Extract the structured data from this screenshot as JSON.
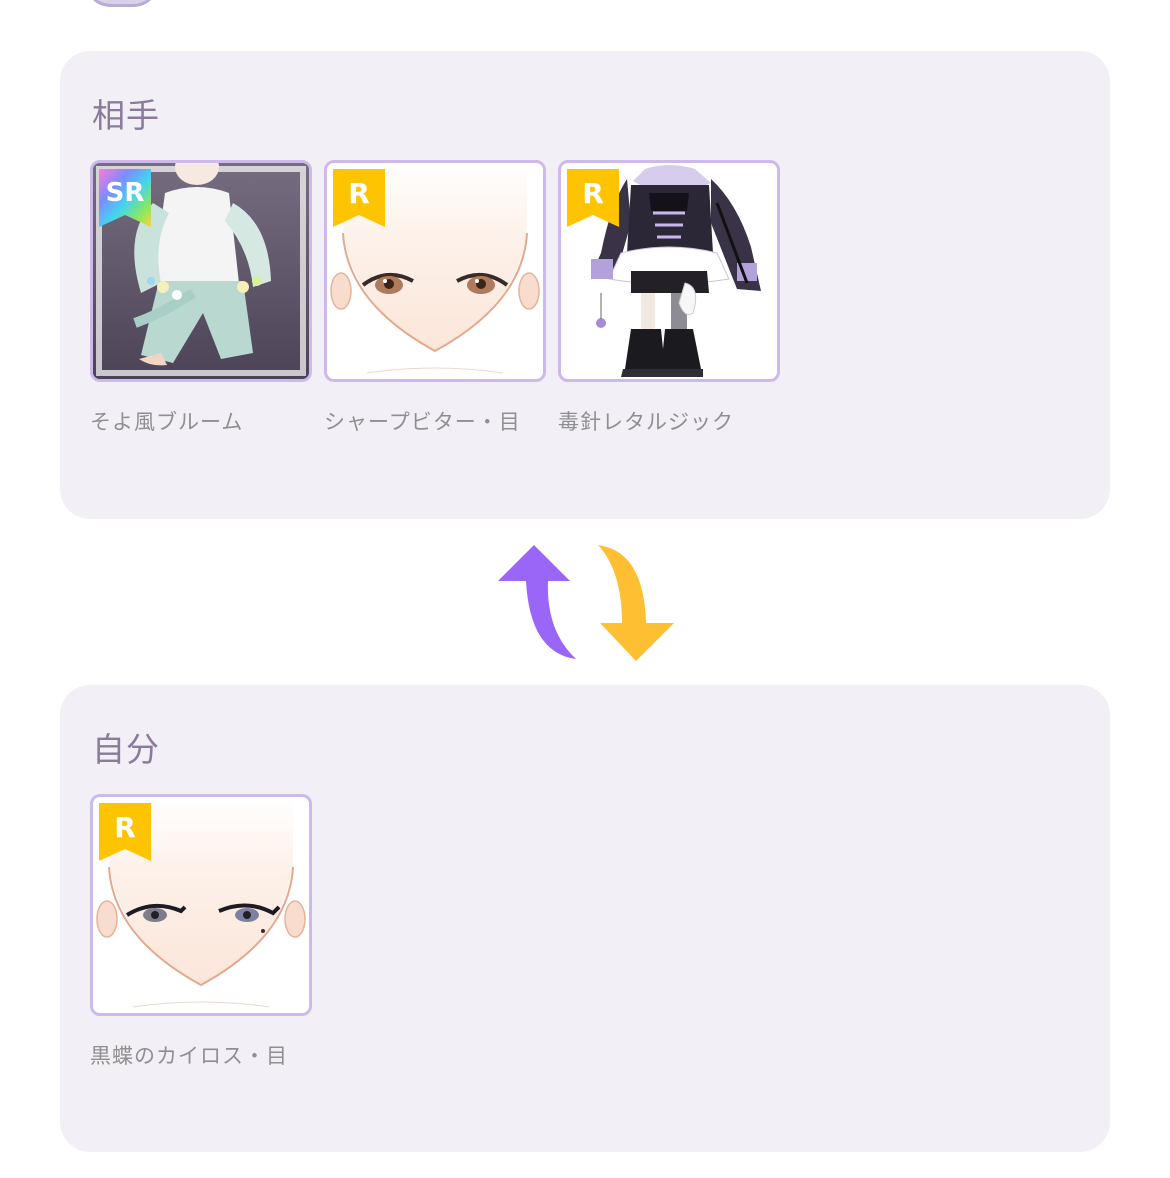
{
  "partner": {
    "title": "相手",
    "items": [
      {
        "name": "そよ風ブルーム",
        "rarity": "SR"
      },
      {
        "name": "シャープビター・目",
        "rarity": "R"
      },
      {
        "name": "毒針レタルジック",
        "rarity": "R"
      }
    ]
  },
  "self": {
    "title": "自分",
    "items": [
      {
        "name": "黒蝶のカイロス・目",
        "rarity": "R"
      }
    ]
  },
  "colors": {
    "panel_bg": "#f2f0f6",
    "card_border": "#cdb9ec",
    "arrow_up": "#9a66f7",
    "arrow_down": "#ffbf33",
    "r_badge": "#ffc400"
  },
  "icons": {
    "swap": "swap-arrows-icon"
  }
}
